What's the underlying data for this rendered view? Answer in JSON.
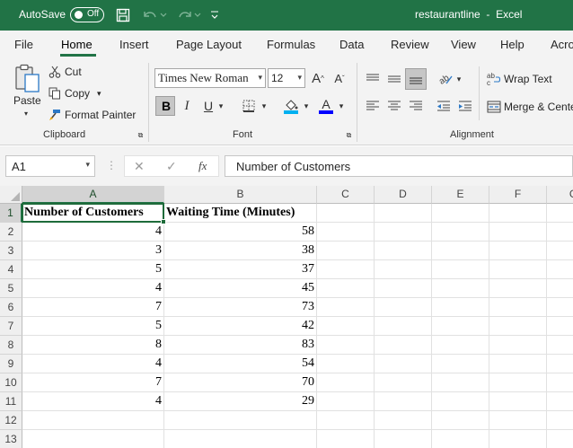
{
  "titlebar": {
    "autosave_label": "AutoSave",
    "autosave_state": "Off",
    "file_name": "restaurantline",
    "separator": "-",
    "app_name": "Excel",
    "color": "#217346"
  },
  "tabs": [
    "File",
    "Home",
    "Insert",
    "Page Layout",
    "Formulas",
    "Data",
    "Review",
    "View",
    "Help",
    "Acro"
  ],
  "active_tab": "Home",
  "ribbon": {
    "clipboard": {
      "paste_label": "Paste",
      "cut_label": "Cut",
      "copy_label": "Copy",
      "format_painter_label": "Format Painter",
      "group_label": "Clipboard"
    },
    "font": {
      "font_name": "Times New Roman",
      "font_size": "12",
      "bold": "B",
      "italic": "I",
      "underline": "U",
      "grow": "A",
      "shrink": "A",
      "font_color_letter": "A",
      "group_label": "Font",
      "fill_color": "#00b0f0",
      "font_color": "#0000ff"
    },
    "alignment": {
      "wrap_text_label": "Wrap Text",
      "merge_label": "Merge & Cente",
      "group_label": "Alignment"
    }
  },
  "formula_bar": {
    "name_box": "A1",
    "fx_label": "fx",
    "content": "Number of Customers"
  },
  "sheet": {
    "columns": [
      "A",
      "B",
      "C",
      "D",
      "E",
      "F",
      "G"
    ],
    "row_numbers": [
      "1",
      "2",
      "3",
      "4",
      "5",
      "6",
      "7",
      "8",
      "9",
      "10",
      "11",
      "12",
      "13"
    ],
    "header_row": [
      "Number of Customers",
      "Waiting Time (Minutes)"
    ],
    "rows": [
      [
        "4",
        "58"
      ],
      [
        "3",
        "38"
      ],
      [
        "5",
        "37"
      ],
      [
        "4",
        "45"
      ],
      [
        "7",
        "73"
      ],
      [
        "5",
        "42"
      ],
      [
        "8",
        "83"
      ],
      [
        "4",
        "54"
      ],
      [
        "7",
        "70"
      ],
      [
        "4",
        "29"
      ]
    ]
  }
}
